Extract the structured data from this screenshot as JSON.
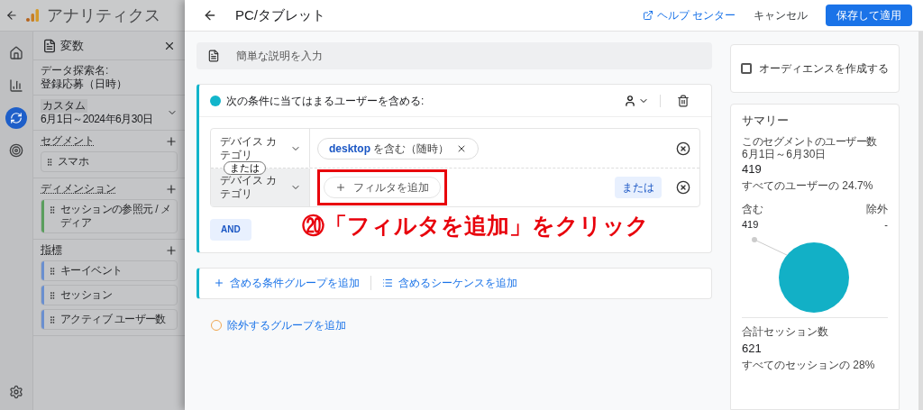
{
  "app_bar": {
    "title": "アナリティクス"
  },
  "rail": [
    {
      "kind": "home",
      "selected": false
    },
    {
      "kind": "reports",
      "selected": false
    },
    {
      "kind": "explore",
      "selected": true
    },
    {
      "kind": "advertising",
      "selected": false
    }
  ],
  "variables_panel": {
    "title": "変数",
    "name_label": "データ探索名:",
    "name_value": "登録応募（日時）",
    "date_label": "カスタム",
    "date_value": "6月1日～2024年6月30日",
    "sections": [
      {
        "title": "セグメント",
        "items": [
          "スマホ"
        ]
      },
      {
        "title": "ディメンション",
        "color": "#5a9e5d",
        "items": [
          "セッションの参照元 / メディア"
        ]
      },
      {
        "title": "指標",
        "color": "#6a8fd0",
        "items": [
          "キーイベント",
          "セッション",
          "アクティブ ユーザー数"
        ]
      }
    ]
  },
  "editor": {
    "title": "PC/タブレット",
    "help_link": "ヘルプ センター",
    "cancel": "キャンセル",
    "save": "保存して適用",
    "description_placeholder": "簡単な説明を入力",
    "include_group": {
      "heading": "次の条件に当てはまるユーザーを含める:",
      "and_button": "AND",
      "conditions": [
        {
          "dimension": "デバイス カテゴリ",
          "filter": "**desktop** を含む（随時）"
        },
        {
          "connector": "または",
          "dimension": "デバイス カテゴリ",
          "add_filter": "フィルタを追加",
          "or_button": "または",
          "highlighted": true
        }
      ]
    },
    "annotation": "⑳「フィルタを追加」をクリック",
    "add_actions": [
      "含める条件グループを追加",
      "含めるシーケンスを追加"
    ],
    "exclude_action": "除外するグループを追加"
  },
  "summary": {
    "audience_checkbox": {
      "label": "オーディエンスを作成する",
      "checked": false
    },
    "title": "サマリー",
    "users_label": "このセグメントのユーザー数",
    "users_range": "6月1日～6月30日",
    "users_value": "419",
    "users_share": "すべてのユーザーの 24.7%",
    "include_label": "含む",
    "exclude_label": "除外",
    "include_value": "419",
    "exclude_value": "-",
    "sessions_label": "合計セッション数",
    "sessions_value": "621",
    "sessions_share": "すべてのセッションの 28%"
  }
}
